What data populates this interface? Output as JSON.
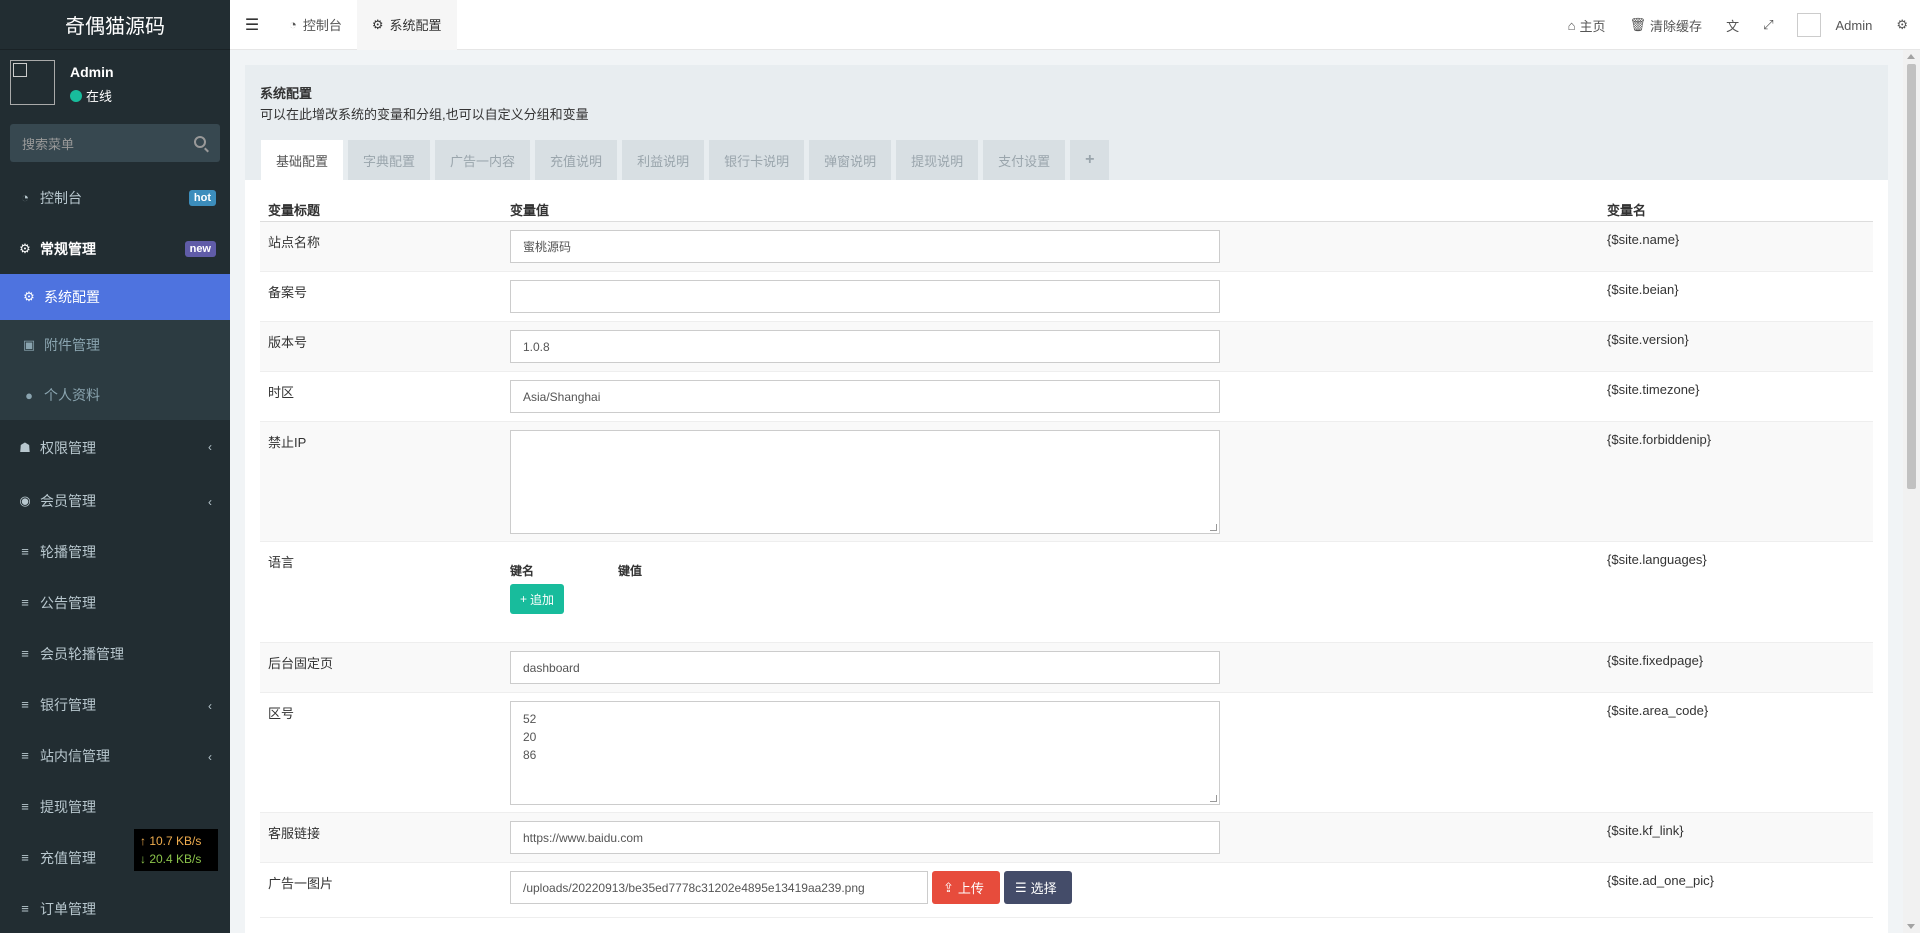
{
  "sidebar": {
    "logo": "奇偶猫源码",
    "user": {
      "name": "Admin",
      "status": "在线"
    },
    "search_placeholder": "搜索菜单",
    "items": [
      {
        "label": "控制台",
        "icon": "dashboard-icon",
        "badge": "hot"
      },
      {
        "label": "常规管理",
        "icon": "cogs-icon",
        "badge": "new"
      },
      {
        "label": "系统配置",
        "icon": "gear-icon"
      },
      {
        "label": "附件管理",
        "icon": "file-image-icon"
      },
      {
        "label": "个人资料",
        "icon": "user-icon"
      },
      {
        "label": "权限管理",
        "icon": "group-icon"
      },
      {
        "label": "会员管理",
        "icon": "user-circle-icon"
      },
      {
        "label": "轮播管理",
        "icon": "list-icon"
      },
      {
        "label": "公告管理",
        "icon": "list-icon"
      },
      {
        "label": "会员轮播管理",
        "icon": "list-icon"
      },
      {
        "label": "银行管理",
        "icon": "list-icon"
      },
      {
        "label": "站内信管理",
        "icon": "list-icon"
      },
      {
        "label": "提现管理",
        "icon": "list-icon"
      },
      {
        "label": "充值管理",
        "icon": "list-icon"
      },
      {
        "label": "订单管理",
        "icon": "list-icon"
      }
    ],
    "netspeed": {
      "up": "↑ 10.7 KB/s",
      "down": "↓ 20.4 KB/s"
    }
  },
  "header": {
    "tabs": [
      {
        "label": "控制台"
      },
      {
        "label": "系统配置"
      }
    ],
    "home": "主页",
    "clear_cache": "清除缓存",
    "admin": "Admin"
  },
  "panel": {
    "title": "系统配置",
    "desc": "可以在此增改系统的变量和分组,也可以自定义分组和变量",
    "tabs": [
      "基础配置",
      "字典配置",
      "广告一内容",
      "充值说明",
      "利益说明",
      "银行卡说明",
      "弹窗说明",
      "提现说明",
      "支付设置",
      "+"
    ]
  },
  "table": {
    "headers": {
      "title": "变量标题",
      "value": "变量值",
      "name": "变量名"
    },
    "rows": [
      {
        "title": "站点名称",
        "value": "蜜桃源码",
        "name": "{$site.name}"
      },
      {
        "title": "备案号",
        "value": "",
        "name": "{$site.beian}"
      },
      {
        "title": "版本号",
        "value": "1.0.8",
        "name": "{$site.version}"
      },
      {
        "title": "时区",
        "value": "Asia/Shanghai",
        "name": "{$site.timezone}"
      },
      {
        "title": "禁止IP",
        "value": "",
        "name": "{$site.forbiddenip}"
      },
      {
        "title": "语言",
        "key_label": "键名",
        "val_label": "键值",
        "add_label": "追加",
        "name": "{$site.languages}"
      },
      {
        "title": "后台固定页",
        "value": "dashboard",
        "name": "{$site.fixedpage}"
      },
      {
        "title": "区号",
        "value": "52\n20\n86",
        "name": "{$site.area_code}"
      },
      {
        "title": "客服链接",
        "value": "https://www.baidu.com",
        "name": "{$site.kf_link}"
      },
      {
        "title": "广告一图片",
        "value": "/uploads/20220913/be35ed7778c31202e4895e13419aa239.png",
        "upload_label": "上传",
        "select_label": "选择",
        "name": "{$site.ad_one_pic}"
      }
    ]
  },
  "colors": {
    "sidebar_bg": "#222d32",
    "active_menu": "#4e73df",
    "add_button": "#18bc9c",
    "upload_button": "#e74c3c",
    "select_button": "#444c69"
  }
}
